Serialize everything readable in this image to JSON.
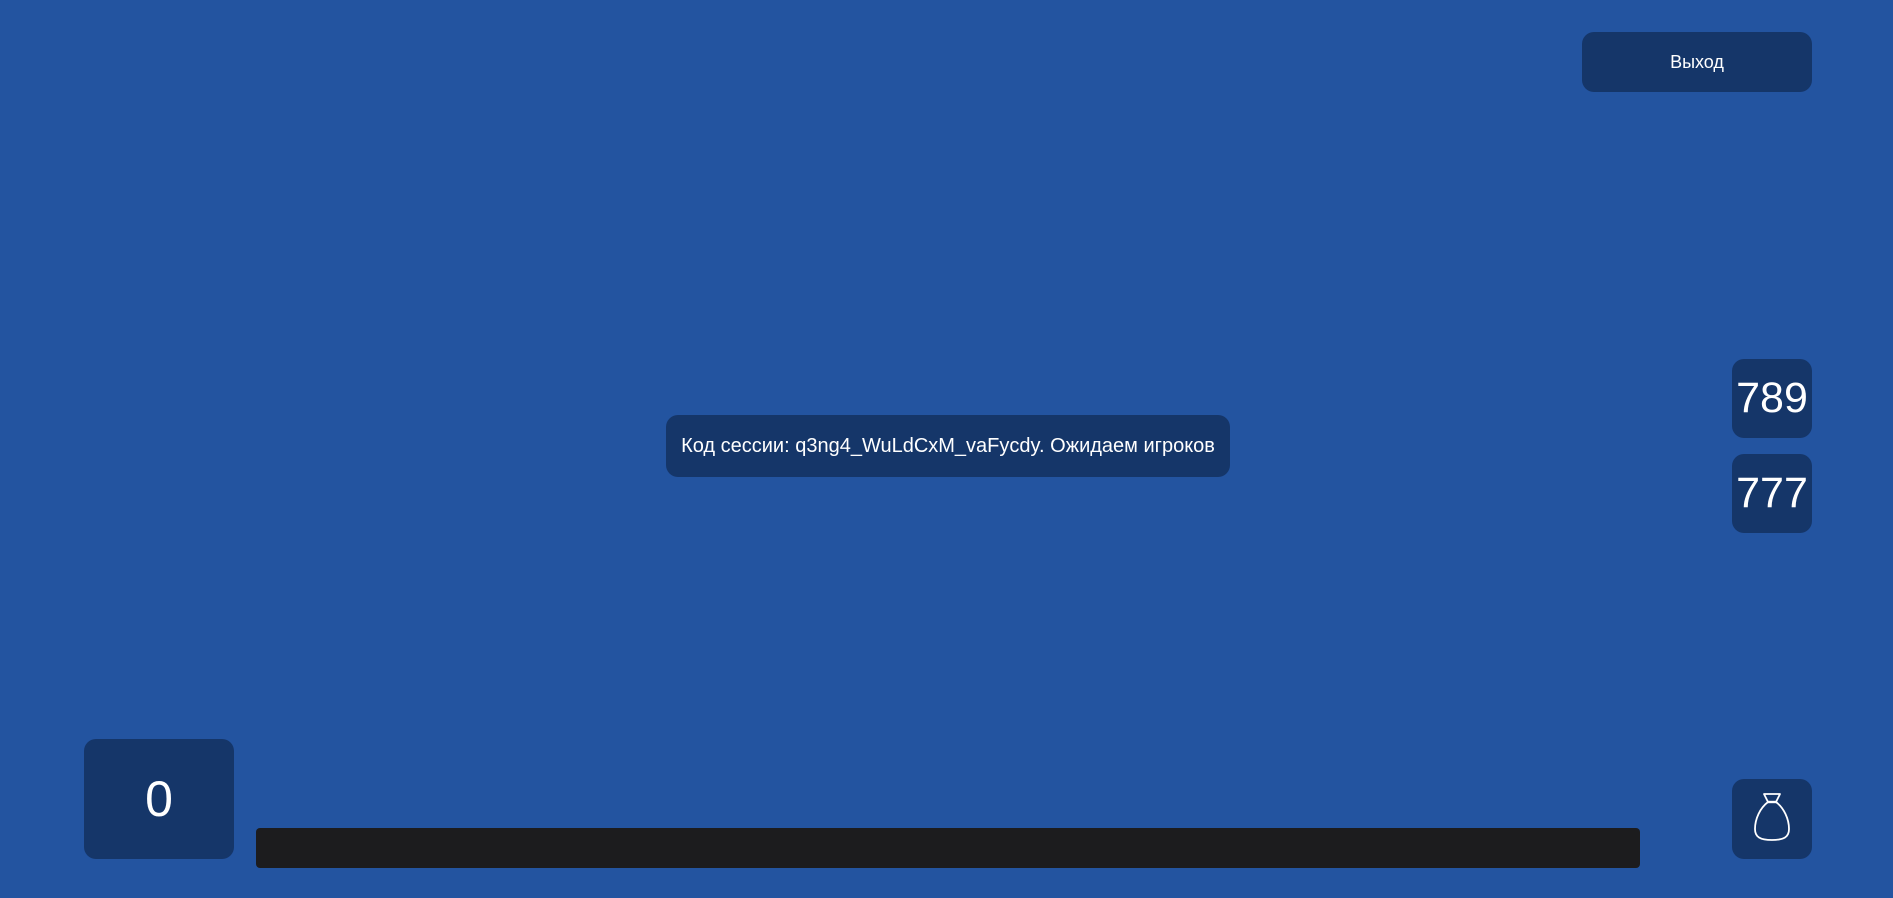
{
  "header": {
    "exit_label": "Выход"
  },
  "session": {
    "message": "Код сессии: q3ng4_WuLdCxM_vaFycdy. Ожидаем игроков"
  },
  "side_scores": [
    {
      "value": "789"
    },
    {
      "value": "777"
    }
  ],
  "player": {
    "score": "0"
  },
  "bag": {
    "icon": "money-bag-icon"
  },
  "progress": {
    "value": 0
  },
  "colors": {
    "background": "#2354a0",
    "panel": "#153669",
    "progress_track": "#1c1c1e",
    "text": "#ffffff"
  }
}
